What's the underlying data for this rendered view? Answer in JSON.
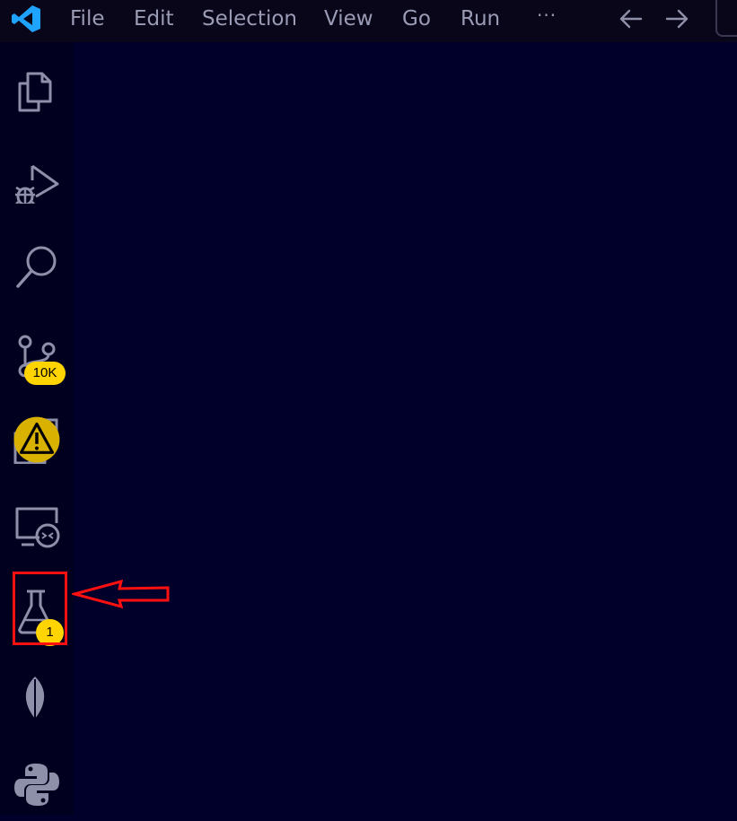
{
  "menu": {
    "items": [
      "File",
      "Edit",
      "Selection",
      "View",
      "Go",
      "Run"
    ],
    "more": "···"
  },
  "icons": {
    "app_logo": "vscode-logo-icon",
    "back": "arrow-left-icon",
    "forward": "arrow-right-icon"
  },
  "activity_bar": {
    "items": [
      {
        "name": "explorer",
        "icon": "files-icon"
      },
      {
        "name": "run-and-debug",
        "icon": "run-debug-icon"
      },
      {
        "name": "search",
        "icon": "search-icon"
      },
      {
        "name": "source-control",
        "icon": "source-control-icon",
        "badge": "10K"
      },
      {
        "name": "extensions",
        "icon": "extensions-icon",
        "badge_icon": "warning-icon"
      },
      {
        "name": "remote-explorer",
        "icon": "remote-explorer-icon"
      },
      {
        "name": "testing",
        "icon": "beaker-icon",
        "badge": "1"
      },
      {
        "name": "mongodb",
        "icon": "leaf-icon"
      },
      {
        "name": "python",
        "icon": "python-icon"
      }
    ]
  },
  "colors": {
    "background": "#00002a",
    "titlebar": "#0a061a",
    "activity_bar": "#01001f",
    "icon": "#8e8fa8",
    "badge": "#ffd400",
    "annotation": "#ff1010",
    "logo": "#1ea4ff"
  }
}
